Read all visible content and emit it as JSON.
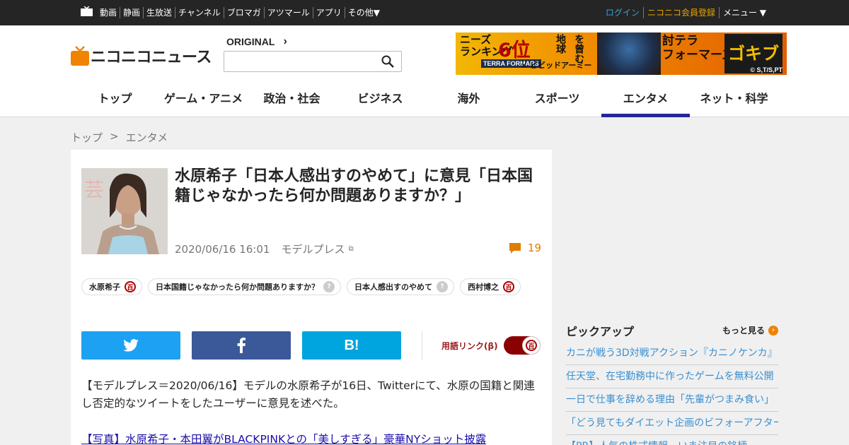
{
  "topbar": {
    "nav": [
      "動画",
      "静画",
      "生放送",
      "チャンネル",
      "ブロマガ",
      "アツマール",
      "アプリ",
      "その他▼"
    ],
    "login": "ログイン",
    "register": "ニコニコ会員登録",
    "menu": "メニュー ▼"
  },
  "header": {
    "logo_text": "ニコニコニュース",
    "original_label": "ORIGINAL",
    "search_placeholder": "",
    "banner": {
      "line1": "ニーズ\nランキング",
      "rank": "6位",
      "earth": "地球",
      "line2": "を曾む",
      "line3": "討テラ\nフォーマーズ",
      "logo": "TERRA FORMARS",
      "collab": "× ビビッドアーミー",
      "tail": "ゴキブリ",
      "copyright": "© S,T/S,PT"
    }
  },
  "catnav": [
    {
      "label": "トップ",
      "active": false
    },
    {
      "label": "ゲーム・アニメ",
      "active": false
    },
    {
      "label": "政治・社会",
      "active": false
    },
    {
      "label": "ビジネス",
      "active": false
    },
    {
      "label": "海外",
      "active": false
    },
    {
      "label": "スポーツ",
      "active": false
    },
    {
      "label": "エンタメ",
      "active": true
    },
    {
      "label": "ネット・科学",
      "active": false
    }
  ],
  "breadcrumb": {
    "home": "トップ",
    "sep": ">",
    "current": "エンタメ"
  },
  "article": {
    "title": "水原希子「日本人感出すのやめて」に意見「日本国籍じゃなかったら何か問題ありますか？」",
    "date": "2020/06/16 16:01",
    "source": "モデルプレス",
    "comment_count": "19",
    "tags": [
      {
        "label": "水原希子",
        "icon": "dic"
      },
      {
        "label": "日本国籍じゃなかったら何か問題ありますか？",
        "icon": "q"
      },
      {
        "label": "日本人感出すのやめて",
        "icon": "q"
      },
      {
        "label": "西村博之",
        "icon": "dic"
      }
    ],
    "term_link_label": "用語リンク",
    "body": "【モデルプレス＝2020/06/16】モデルの水原希子が16日、Twitterにて、水原の国籍と関連し否定的なツイートをしたユーザーに意見を述べた。",
    "body_link": "【写真】水原希子・本田翼がBLACKPINKとの「美しすぎる」豪華NYショット披露"
  },
  "sidebar": {
    "pickup_title": "ピックアップ",
    "more_label": "もっと見る",
    "items": [
      "カニが戦う3D対戦アクション『カニノケンカ』",
      "任天堂、在宅勤務中に作ったゲームを無料公開",
      "一日で仕事を辞める理由「先輩がつまみ食い」",
      "「どう見てもダイエット企画のビフォーアフター」",
      "【PR】人気の株式情報、いま注目の銘柄"
    ]
  },
  "colors": {
    "active_underline": "#252598",
    "link": "#3a8fd0",
    "comment": "#e07b00",
    "twitter": "#1da1f2",
    "facebook": "#3b5998",
    "hatena": "#00a4de"
  }
}
